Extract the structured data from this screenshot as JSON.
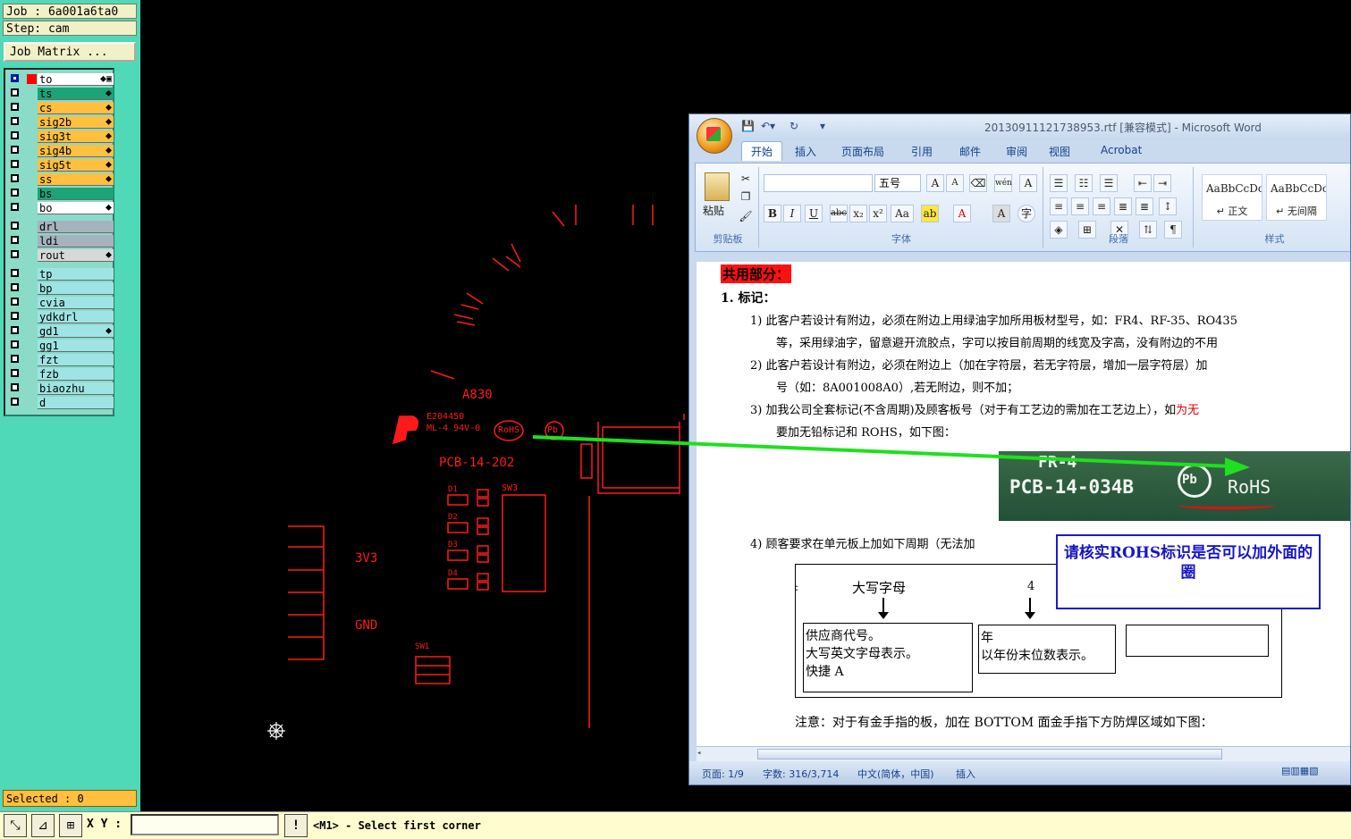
{
  "cam": {
    "job_label": "Job : 6a001a6ta0",
    "step_label": "Step: cam",
    "job_matrix_button": "Job Matrix ...",
    "selected_label": "Selected : 0",
    "layers": [
      {
        "name": "to",
        "color": "#ffffff",
        "flag": "⬥▣",
        "checked": true,
        "red": true
      },
      {
        "name": "ts",
        "color": "#1aa478",
        "flag": "⬥"
      },
      {
        "name": "cs",
        "color": "#ffbf3f",
        "flag": "⬥"
      },
      {
        "name": "sig2b",
        "color": "#ffbf3f",
        "flag": "⬥"
      },
      {
        "name": "sig3t",
        "color": "#ffbf3f",
        "flag": "⬥"
      },
      {
        "name": "sig4b",
        "color": "#ffbf3f",
        "flag": "⬥"
      },
      {
        "name": "sig5t",
        "color": "#ffbf3f",
        "flag": "⬥"
      },
      {
        "name": "ss",
        "color": "#ffbf3f",
        "flag": "⬥"
      },
      {
        "name": "bs",
        "color": "#1aa478",
        "flag": ""
      },
      {
        "name": "bo",
        "color": "#ffffff",
        "flag": "⬥"
      },
      {
        "name": "drl",
        "color": "#a7b2bf",
        "flag": ""
      },
      {
        "name": "ldi",
        "color": "#a7b2bf",
        "flag": ""
      },
      {
        "name": "rout",
        "color": "#d8d8d8",
        "flag": "⬥"
      },
      {
        "name": "tp",
        "color": "#9fe4e4",
        "flag": ""
      },
      {
        "name": "bp",
        "color": "#9fe4e4",
        "flag": ""
      },
      {
        "name": "cvia",
        "color": "#9fe4e4",
        "flag": ""
      },
      {
        "name": "ydkdrl",
        "color": "#9fe4e4",
        "flag": ""
      },
      {
        "name": "gd1",
        "color": "#9fe4e4",
        "flag": "⬥"
      },
      {
        "name": "gg1",
        "color": "#9fe4e4",
        "flag": ""
      },
      {
        "name": "fzt",
        "color": "#9fe4e4",
        "flag": ""
      },
      {
        "name": "fzb",
        "color": "#9fe4e4",
        "flag": ""
      },
      {
        "name": "biaozhu",
        "color": "#9fe4e4",
        "flag": ""
      },
      {
        "name": "d",
        "color": "#9fe4e4",
        "flag": ""
      }
    ],
    "bottom": {
      "xy_label": "X Y :",
      "coord_value": "",
      "prompt": "<M1> - Select first corner"
    },
    "pcb_labels": {
      "board_code": "A830",
      "ul_mark": "E204450",
      "rating": "ML-4 94V-0",
      "rohs": "RoHS",
      "pb": "Pb",
      "part_no": "PCB-14-202",
      "sw3": "SW3",
      "sw1": "SW1",
      "d1": "D1",
      "d2": "D2",
      "d3": "D3",
      "d4": "D4",
      "v33": "3V3",
      "gnd": "GND"
    }
  },
  "word": {
    "title": "20130911121738953.rtf [兼容模式] - Microsoft Word",
    "tabs": [
      "开始",
      "插入",
      "页面布局",
      "引用",
      "邮件",
      "审阅",
      "视图",
      "Acrobat"
    ],
    "active_tab": "开始",
    "groups": {
      "clipboard": "剪贴板",
      "font": "字体",
      "paragraph": "段落",
      "styles": "样式"
    },
    "paste_label": "粘贴",
    "font_size": "五号",
    "font_name": "",
    "styles": [
      {
        "sample": "AaBbCcDc",
        "name": "↵ 正文"
      },
      {
        "sample": "AaBbCcDc",
        "name": "↵ 无间隔"
      }
    ],
    "doc": {
      "heading": "共用部分：",
      "section1": "1.   标记：",
      "item1_a": "1)  此客户若设计有附边，必须在附边上用绿油字加所用板材型号，如：FR4、RF-35、RO435",
      "item1_b": "等，采用绿油字，留意避开流胶点，字可以按目前周期的线宽及字高，没有附边的不用",
      "item2_a": "2)  此客户若设计有附边，必须在附边上（加在字符层，若无字符层，增加一层字符层）加",
      "item2_b": "号（如：8A001008A0）,若无附边，则不加；",
      "item3_a": "3)  加我公司全套标记(不含周期)及顾客板号（对于有工艺边的需加在工艺边上），如",
      "item3_red": "为无",
      "item3_b": "要加无铅标记和 ROHS，如下图：",
      "item4": "4)  顾客要求在单元板上加如下周期（无法加",
      "photo_line1": "FR-4",
      "photo_line2": "PCB-14-034B",
      "photo_pb": "Pb",
      "photo_rohs": "RoHS",
      "callout": "请核实ROHS标识是否可以加外面的圈",
      "label_upper": "大写字母",
      "label_4": "4",
      "box1_l1": "供应商代号。",
      "box1_l2": "大写英文字母表示。",
      "box1_l3": "快捷  A",
      "box2_l1": "年",
      "box2_l2": "以年份末位数表示。",
      "colon": ":",
      "note": "注意：对于有金手指的板，加在 BOTTOM 面金手指下方防焊区域如下图："
    },
    "status": {
      "page": "页面: 1/9",
      "words": "字数: 316/3,714",
      "lang": "中文(简体，中国)",
      "mode": "插入"
    }
  }
}
